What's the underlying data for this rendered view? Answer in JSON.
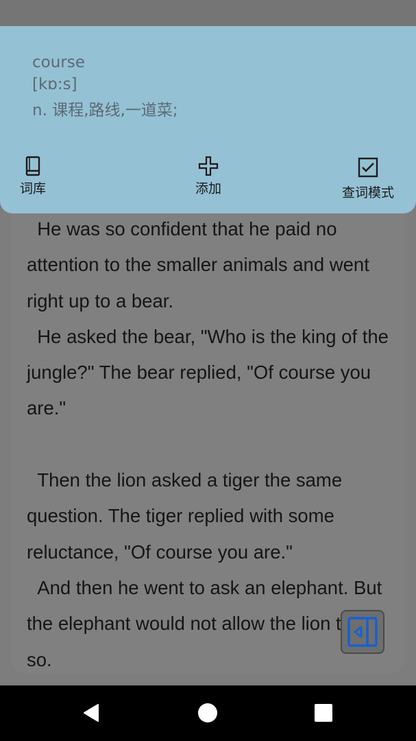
{
  "dictionary_popup": {
    "word": "course",
    "phonetic": "[kɒ:s]",
    "definition": "n. 课程,路线,一道菜;",
    "actions": [
      {
        "label": "词库",
        "icon": "book-icon"
      },
      {
        "label": "添加",
        "icon": "plus-icon"
      },
      {
        "label": "查词模式",
        "icon": "checkbox-checked-icon"
      }
    ]
  },
  "reader": {
    "paragraphs": [
      "  He was so confident that he paid no attention to the smaller animals and went right up to a bear.",
      "  He asked the bear, \"Who is the king of the jungle?\" The bear replied, \"Of course you are.\"",
      "",
      "  Then the lion asked a tiger the same question. The tiger replied with some reluctance, \"Of course you are.\"",
      "  And then he went to ask an elephant. But the elephant would not allow the lion to do so."
    ]
  },
  "side_panel_toggle": {
    "icon": "panel-collapse-icon",
    "color": "#1a5fd0"
  },
  "navigation_bar": {
    "buttons": [
      "back-icon",
      "home-icon",
      "recents-icon"
    ]
  },
  "colors": {
    "popup_background": "#95c1d5",
    "overlay_background": "#7d7d7d",
    "reader_text": "#151515"
  }
}
